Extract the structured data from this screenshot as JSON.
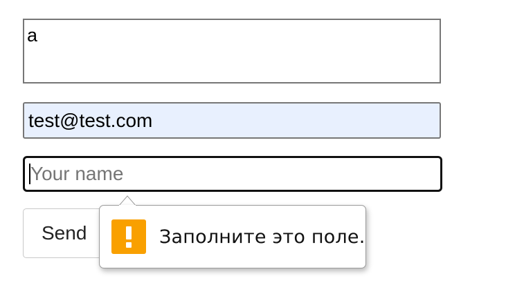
{
  "form": {
    "message_value": "a",
    "email_value": "test@test.com",
    "name_placeholder": "Your name",
    "send_label": "Send"
  },
  "validation_tooltip": {
    "icon": "warning-icon",
    "message": "Заполните это поле."
  },
  "colors": {
    "autofill_bg": "#e8f0fe",
    "warning_icon_bg": "#f9a000",
    "focus_border": "#101010"
  }
}
